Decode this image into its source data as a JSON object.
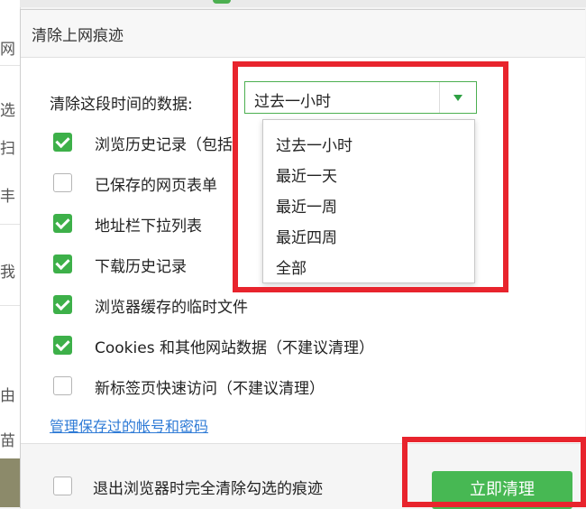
{
  "background": {
    "left_fragments": [
      "网",
      "选",
      "扫",
      "丰",
      "我",
      "由",
      "苗"
    ]
  },
  "dialog": {
    "title": "清除上网痕迹",
    "time_range": {
      "label": "清除这段时间的数据:",
      "selected": "过去一小时",
      "options": [
        "过去一小时",
        "最近一天",
        "最近一周",
        "最近四周",
        "全部"
      ]
    },
    "items": [
      {
        "label": "浏览历史记录（包括",
        "checked": true
      },
      {
        "label": "已保存的网页表单",
        "checked": false
      },
      {
        "label": "地址栏下拉列表",
        "checked": true
      },
      {
        "label": "下载历史记录",
        "checked": true
      },
      {
        "label": "浏览器缓存的临时文件",
        "checked": true
      },
      {
        "label": "Cookies 和其他网站数据（不建议清理）",
        "checked": true
      },
      {
        "label": "新标签页快速访问（不建议清理）",
        "checked": false
      }
    ],
    "manage_link": "管理保存过的帐号和密码",
    "footer": {
      "exit_clear_label": "退出浏览器时完全清除勾选的痕迹",
      "exit_clear_checked": false,
      "clear_button": "立即清理"
    }
  },
  "colors": {
    "accent_green": "#3db049",
    "link_blue": "#2f7bd6",
    "highlight_red": "#e8242d"
  },
  "icons": [
    "dropdown-arrow-icon",
    "checkbox-checked-icon",
    "checkbox-unchecked-icon"
  ]
}
